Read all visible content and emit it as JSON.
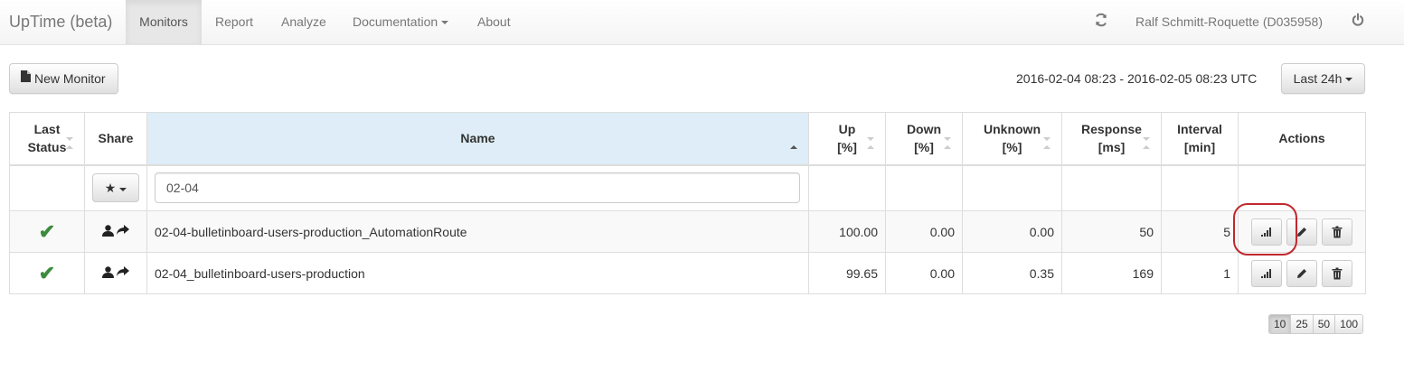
{
  "navbar": {
    "brand": "UpTime (beta)",
    "items": [
      {
        "label": "Monitors",
        "active": true
      },
      {
        "label": "Report",
        "active": false
      },
      {
        "label": "Analyze",
        "active": false
      },
      {
        "label": "Documentation",
        "active": false,
        "dropdown": true
      },
      {
        "label": "About",
        "active": false
      }
    ],
    "refresh_icon": "refresh-icon",
    "user": "Ralf Schmitt-Roquette (D035958)",
    "power_icon": "power-icon"
  },
  "toolbar": {
    "new_monitor_label": "New Monitor",
    "new_monitor_icon": "file-icon",
    "date_range": "2016-02-04 08:23 - 2016-02-05 08:23 UTC",
    "range_select": "Last 24h"
  },
  "table": {
    "headers": {
      "last_status_1": "Last",
      "last_status_2": "Status",
      "share": "Share",
      "name": "Name",
      "up_1": "Up",
      "up_2": "[%]",
      "down_1": "Down",
      "down_2": "[%]",
      "unknown_1": "Unknown",
      "unknown_2": "[%]",
      "response_1": "Response",
      "response_2": "[ms]",
      "interval_1": "Interval",
      "interval_2": "[min]",
      "actions": "Actions"
    },
    "sorted_column": "name",
    "filter": {
      "share_filter_icon": "star-icon",
      "name_value": "02-04"
    },
    "rows": [
      {
        "status": "ok",
        "status_icon": "check-icon",
        "name": "02-04-bulletinboard-users-production_AutomationRoute",
        "up": "100.00",
        "down": "0.00",
        "unknown": "0.00",
        "response": "50",
        "interval": "5"
      },
      {
        "status": "ok",
        "status_icon": "check-icon",
        "name": "02-04_bulletinboard-users-production",
        "up": "99.65",
        "down": "0.00",
        "unknown": "0.35",
        "response": "169",
        "interval": "1"
      }
    ]
  },
  "pagination": {
    "options": [
      "10",
      "25",
      "50",
      "100"
    ],
    "active": "10"
  },
  "colors": {
    "status_ok": "#3c8b3c",
    "sorted_header_bg": "#deedf7",
    "highlight_circle": "#c0282d"
  }
}
